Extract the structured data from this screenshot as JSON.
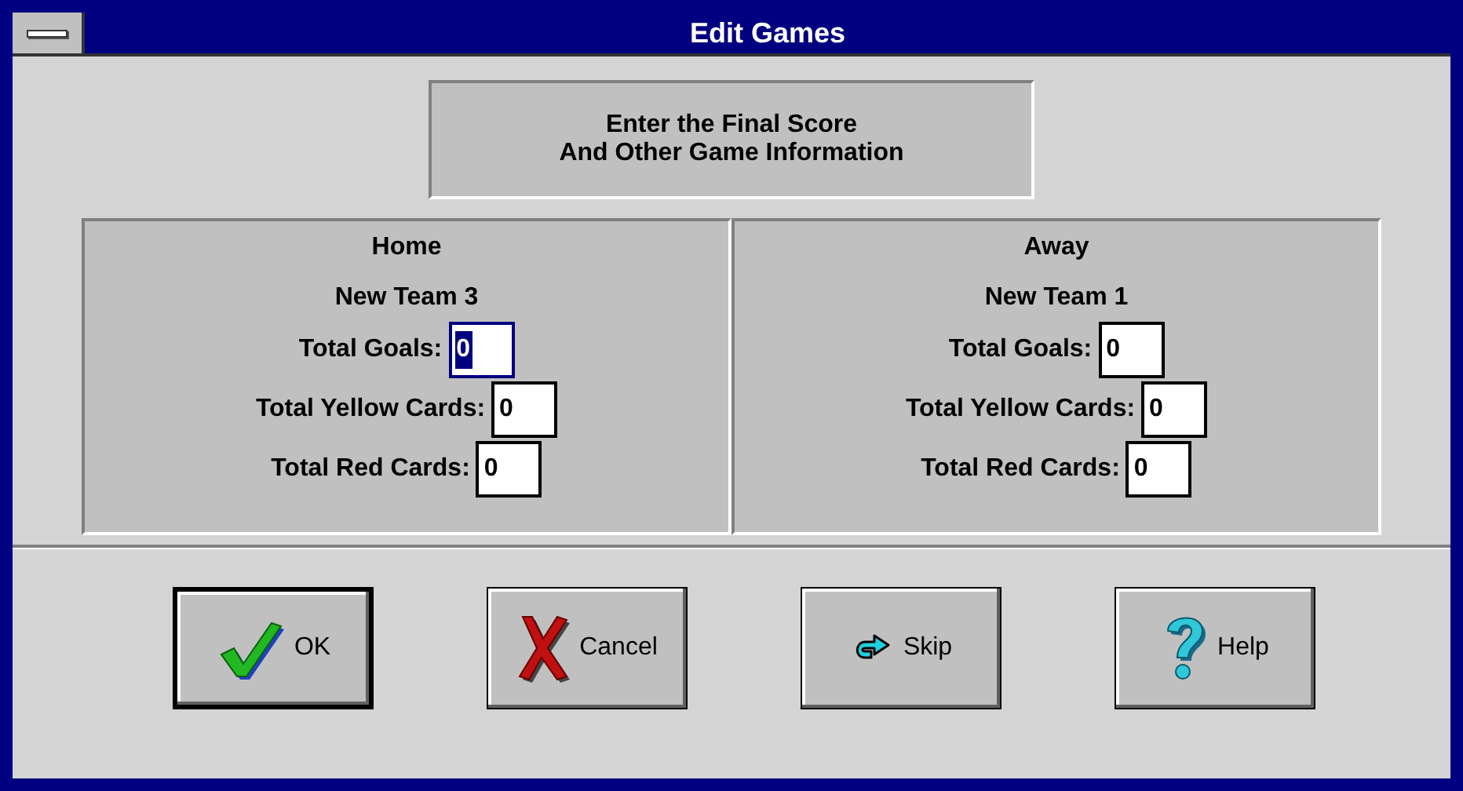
{
  "window": {
    "title": "Edit Games"
  },
  "instructions": [
    "Enter the Final Score",
    "And Other Game Information"
  ],
  "teams": [
    {
      "side": "Home",
      "name": "New Team 3",
      "fields": [
        {
          "label": "Total Goals:",
          "value": "0",
          "focused": true
        },
        {
          "label": "Total Yellow Cards:",
          "value": "0",
          "focused": false
        },
        {
          "label": "Total Red Cards:",
          "value": "0",
          "focused": false
        }
      ]
    },
    {
      "side": "Away",
      "name": "New Team 1",
      "fields": [
        {
          "label": "Total Goals:",
          "value": "0",
          "focused": false
        },
        {
          "label": "Total Yellow Cards:",
          "value": "0",
          "focused": false
        },
        {
          "label": "Total Red Cards:",
          "value": "0",
          "focused": false
        }
      ]
    }
  ],
  "buttons": [
    {
      "kind": "ok",
      "label": "OK",
      "default": true
    },
    {
      "kind": "cancel",
      "label": "Cancel",
      "default": false
    },
    {
      "kind": "skip",
      "label": "Skip",
      "default": false
    },
    {
      "kind": "help",
      "label": "Help",
      "default": false
    }
  ]
}
